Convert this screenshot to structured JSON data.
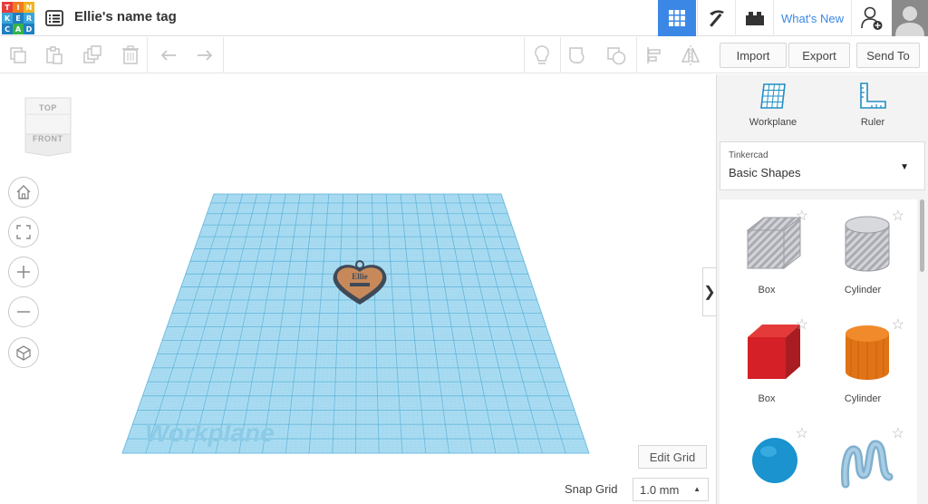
{
  "app": {
    "logo_letters": [
      "T",
      "I",
      "N",
      "K",
      "E",
      "R",
      "C",
      "A",
      "D"
    ],
    "logo_colors": [
      "#e63d3d",
      "#f07b1f",
      "#f0b422",
      "#3aa5dc",
      "#1e7fc1",
      "#3aa5dc",
      "#1e7fc1",
      "#37b34a",
      "#1e7fc1"
    ],
    "doc_title": "Ellie's name tag"
  },
  "topbar": {
    "menu_icon": "list-menu-icon",
    "view_3d_icon": "grid-view-icon",
    "build_icon": "pickaxe-icon",
    "bricks_icon": "brick-icon",
    "whats_new": "What's New",
    "user_icon": "add-user-icon",
    "accent": "#3b87e6"
  },
  "toolbar": {
    "tools": [
      "copy",
      "paste",
      "duplicate",
      "delete",
      "undo",
      "redo",
      "light-bulb",
      "group",
      "ungroup",
      "align",
      "mirror"
    ]
  },
  "actions": {
    "import": "Import",
    "export": "Export",
    "send_to": "Send To"
  },
  "viewcube": {
    "top": "TOP",
    "front": "FRONT"
  },
  "nav": [
    "home-view",
    "fit-all",
    "zoom-in",
    "zoom-out",
    "perspective"
  ],
  "workplane": {
    "watermark": "Workplane",
    "color": "#8fd3ef",
    "tag_text": "Ellie",
    "tag_color": "#c8895a"
  },
  "grid": {
    "edit_label": "Edit Grid",
    "snap_label": "Snap Grid",
    "snap_value": "1.0 mm"
  },
  "panel": {
    "workplane_label": "Workplane",
    "ruler_label": "Ruler",
    "library_small": "Tinkercad",
    "library_main": "Basic Shapes",
    "shapes": [
      {
        "name": "Box",
        "kind": "box-hole"
      },
      {
        "name": "Cylinder",
        "kind": "cylinder-hole"
      },
      {
        "name": "Box",
        "kind": "box"
      },
      {
        "name": "Cylinder",
        "kind": "cylinder"
      },
      {
        "name": "",
        "kind": "sphere"
      },
      {
        "name": "",
        "kind": "scribble"
      }
    ]
  }
}
